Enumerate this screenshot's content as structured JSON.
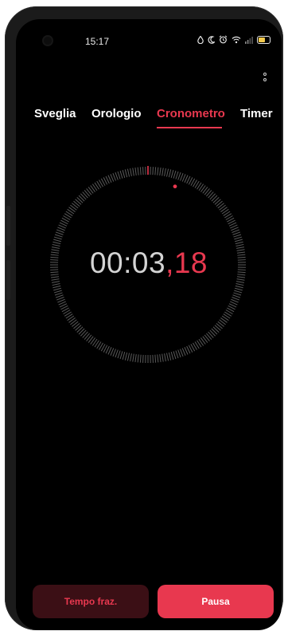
{
  "status_bar": {
    "time": "15:17",
    "icons": [
      "water-drop-icon",
      "moon-icon",
      "alarm-icon",
      "wifi-icon",
      "signal-icon",
      "battery-icon"
    ]
  },
  "menu": {
    "icon": "more-vertical-icon"
  },
  "tabs": [
    {
      "label": "Sveglia",
      "active": false
    },
    {
      "label": "Orologio",
      "active": false
    },
    {
      "label": "Cronometro",
      "active": true
    },
    {
      "label": "Timer",
      "active": false
    }
  ],
  "stopwatch": {
    "main": "00:03",
    "separator": ",",
    "hundredths": "18",
    "progress_seconds": 3.18
  },
  "buttons": {
    "lap_label": "Tempo fraz.",
    "pause_label": "Pausa"
  },
  "colors": {
    "accent": "#e8384f",
    "background": "#000000",
    "lap_button_bg": "#3b0f15"
  }
}
